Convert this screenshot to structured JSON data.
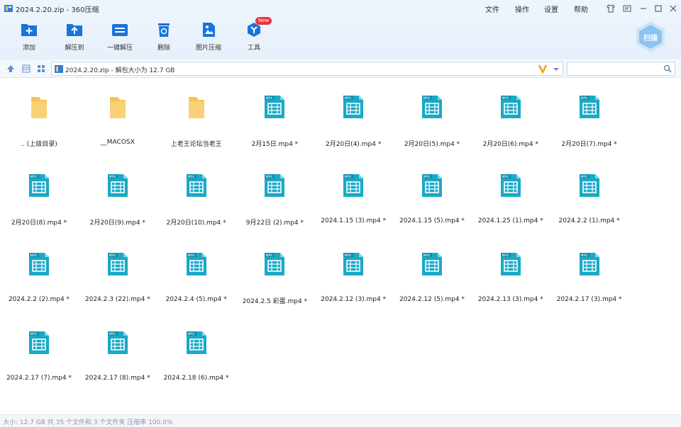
{
  "window": {
    "title": "2024.2.20.zip - 360压缩",
    "menu": [
      "文件",
      "操作",
      "设置",
      "帮助"
    ]
  },
  "toolbar": {
    "buttons": [
      {
        "label": "添加",
        "icon": "add-icon"
      },
      {
        "label": "解压到",
        "icon": "extract-to-icon"
      },
      {
        "label": "一键解压",
        "icon": "one-click-extract-icon"
      },
      {
        "label": "删除",
        "icon": "trash-icon"
      },
      {
        "label": "图片压缩",
        "icon": "image-compress-icon"
      },
      {
        "label": "工具",
        "icon": "tools-icon"
      }
    ],
    "new_badge": "New",
    "scan_label": "扫描"
  },
  "address": {
    "path": "2024.2.20.zip - 解包大小为 12.7 GB",
    "search_placeholder": ""
  },
  "files": [
    {
      "name": ".. (上级目录)",
      "type": "folder"
    },
    {
      "name": "__MACOSX",
      "type": "folder"
    },
    {
      "name": "上老王论坛当老王",
      "type": "folder"
    },
    {
      "name": "2月15日.mp4 *",
      "type": "mp4"
    },
    {
      "name": "2月20日(4).mp4 *",
      "type": "mp4"
    },
    {
      "name": "2月20日(5).mp4 *",
      "type": "mp4"
    },
    {
      "name": "2月20日(6).mp4 *",
      "type": "mp4"
    },
    {
      "name": "2月20日(7).mp4 *",
      "type": "mp4"
    },
    {
      "name": "2月20日(8).mp4 *",
      "type": "mp4"
    },
    {
      "name": "2月20日(9).mp4 *",
      "type": "mp4"
    },
    {
      "name": "2月20日(10).mp4 *",
      "type": "mp4"
    },
    {
      "name": "9月22日 (2).mp4 *",
      "type": "mp4"
    },
    {
      "name": "2024.1.15 (3).mp4 *",
      "type": "mp4"
    },
    {
      "name": "2024.1.15 (5).mp4 *",
      "type": "mp4"
    },
    {
      "name": "2024.1.25 (1).mp4 *",
      "type": "mp4"
    },
    {
      "name": "2024.2.2 (1).mp4 *",
      "type": "mp4"
    },
    {
      "name": "2024.2.2 (2).mp4 *",
      "type": "mp4"
    },
    {
      "name": "2024.2.3 (22).mp4 *",
      "type": "mp4"
    },
    {
      "name": "2024.2.4 (5).mp4 *",
      "type": "mp4"
    },
    {
      "name": "2024.2.5 彩蛋.mp4 *",
      "type": "mp4"
    },
    {
      "name": "2024.2.12 (3).mp4 *",
      "type": "mp4"
    },
    {
      "name": "2024.2.12 (5).mp4 *",
      "type": "mp4"
    },
    {
      "name": "2024.2.13 (3).mp4 *",
      "type": "mp4"
    },
    {
      "name": "2024.2.17 (3).mp4 *",
      "type": "mp4"
    },
    {
      "name": "2024.2.17 (7).mp4 *",
      "type": "mp4"
    },
    {
      "name": "2024.2.17 (8).mp4 *",
      "type": "mp4"
    },
    {
      "name": "2024.2.18 (6).mp4 *",
      "type": "mp4"
    }
  ],
  "file_icon_caption": "MP4",
  "status": {
    "text": "大小: 12.7 GB 共 35 个文件和 3 个文件夹 压缩率 100.0%"
  },
  "colors": {
    "accent": "#1a73d9",
    "folder": "#f5c451",
    "mp4": "#19a9c6"
  }
}
